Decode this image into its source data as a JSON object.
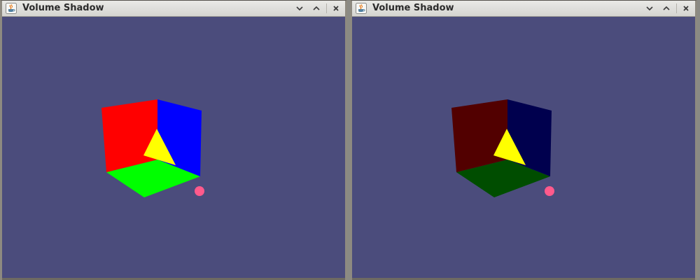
{
  "windows": [
    {
      "title": "Volume Shadow",
      "icon": "java-cup-icon",
      "controls": [
        "chevron-down-icon",
        "chevron-up-icon",
        "close-icon"
      ],
      "scene": {
        "background": "#4b4c7c",
        "colors": {
          "left_wall": "#ff0000",
          "right_wall": "#0000ff",
          "floor": "#00ff00",
          "triangle": "#ffff00",
          "light": "#ff5a8c"
        }
      }
    },
    {
      "title": "Volume Shadow",
      "icon": "java-cup-icon",
      "controls": [
        "chevron-down-icon",
        "chevron-up-icon",
        "close-icon"
      ],
      "scene": {
        "background": "#4b4c7c",
        "colors": {
          "left_wall": "#520000",
          "right_wall": "#00004e",
          "floor": "#004d00",
          "triangle": "#ffff00",
          "light": "#ff5a8c"
        }
      }
    }
  ]
}
